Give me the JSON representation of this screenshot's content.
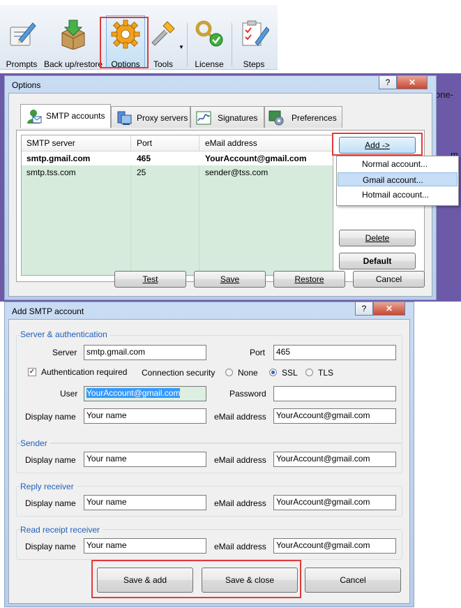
{
  "toolbar": {
    "buttons": [
      {
        "label": "Prompts"
      },
      {
        "label": "Back up/restore"
      },
      {
        "label": "Options"
      },
      {
        "label": "Tools"
      },
      {
        "label": "License"
      },
      {
        "label": "Steps"
      }
    ]
  },
  "background_fragments": [
    "one-",
    "m"
  ],
  "options_window": {
    "title": "Options",
    "tabs": [
      "SMTP accounts",
      "Proxy servers",
      "Signatures",
      "Preferences"
    ],
    "columns": [
      "SMTP server",
      "Port",
      "eMail address"
    ],
    "rows": [
      {
        "server": "smtp.gmail.com",
        "port": "465",
        "email": "YourAccount@gmail.com"
      },
      {
        "server": "smtp.tss.com",
        "port": "25",
        "email": "sender@tss.com"
      }
    ],
    "side_buttons": {
      "add": "Add ->",
      "delete": "Delete",
      "default": "Default"
    },
    "add_menu": [
      "Normal account...",
      "Gmail account...",
      "Hotmail account..."
    ],
    "bottom_buttons": [
      "Test",
      "Save",
      "Restore",
      "Cancel"
    ]
  },
  "smtp_window": {
    "title": "Add SMTP account",
    "server_auth": {
      "title": "Server & authentication",
      "server_label": "Server",
      "server_value": "smtp.gmail.com",
      "port_label": "Port",
      "port_value": "465",
      "auth_label": "Authentication required",
      "security_label": "Connection security",
      "options": [
        "None",
        "SSL",
        "TLS"
      ],
      "selected": "SSL",
      "user_label": "User",
      "user_value": "YourAccount@gmail.com",
      "password_label": "Password",
      "password_value": "",
      "display_label": "Display name",
      "display_value": "Your name",
      "email_label": "eMail address",
      "email_value": "YourAccount@gmail.com"
    },
    "sender": {
      "title": "Sender",
      "display_label": "Display name",
      "display_value": "Your name",
      "email_label": "eMail address",
      "email_value": "YourAccount@gmail.com"
    },
    "reply": {
      "title": "Reply receiver",
      "display_label": "Display name",
      "display_value": "Your name",
      "email_label": "eMail address",
      "email_value": "YourAccount@gmail.com"
    },
    "receipt": {
      "title": "Read receipt receiver",
      "display_label": "Display name",
      "display_value": "Your name",
      "email_label": "eMail address",
      "email_value": "YourAccount@gmail.com"
    },
    "buttons": [
      "Save & add",
      "Save & close",
      "Cancel"
    ]
  },
  "colors": {
    "highlight_box": "#e23a3a",
    "group_title": "#1f5fb8",
    "grid_green": "#d6ebdc",
    "selection_blue": "#3399ff"
  }
}
